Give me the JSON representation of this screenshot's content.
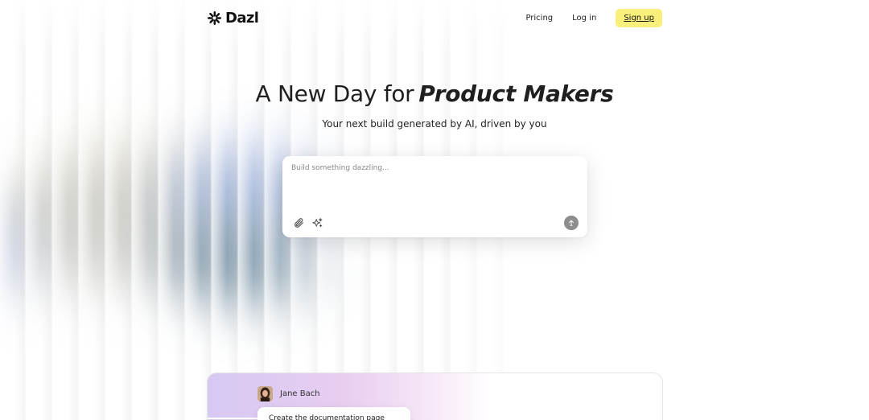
{
  "app": {
    "brand": "Dazl",
    "accent_color": "#f8f07a"
  },
  "header": {
    "logo_icon": "asterisk-star-icon",
    "nav": {
      "pricing_label": "Pricing",
      "login_label": "Log in",
      "signup_label": "Sign up"
    }
  },
  "hero": {
    "title_plain": "A New Day for",
    "title_emphasis": "Product Makers",
    "subtitle": "Your next build generated by AI, driven by you"
  },
  "prompt": {
    "placeholder": "Build something dazzling...",
    "attach_icon": "paperclip-icon",
    "magic_icon": "sparkles-icon",
    "send_icon": "arrow-up-icon"
  },
  "preview": {
    "user_name": "Jane Bach",
    "message": "Create the documentation page"
  }
}
